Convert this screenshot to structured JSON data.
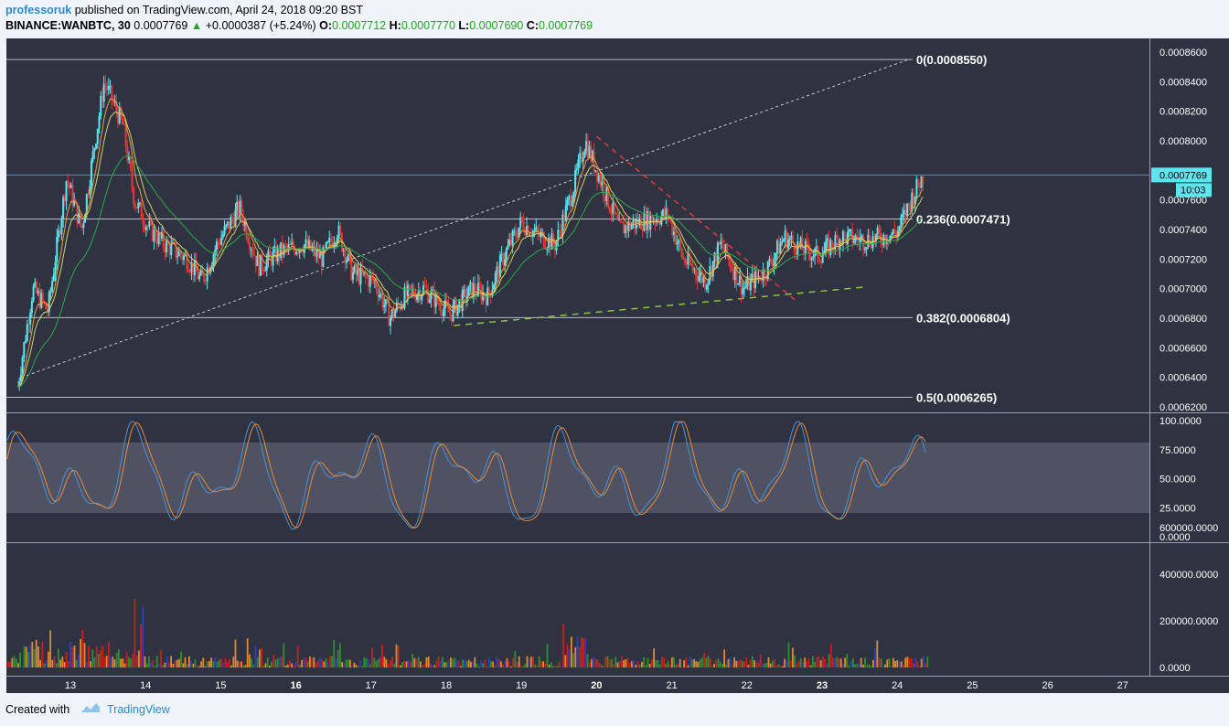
{
  "header": {
    "author": "professoruk",
    "published_text": "published on TradingView.com, April 24, 2018 09:20 BST",
    "symbol": "BINANCE:WANBTC, 30",
    "last": "0.0007769",
    "change_arrow": "▲",
    "change": "+0.0000387 (+5.24%)",
    "o_label": "O:",
    "o": "0.0007712",
    "h_label": "H:",
    "h": "0.0007770",
    "l_label": "L:",
    "l": "0.0007690",
    "c_label": "C:",
    "c": "0.0007769"
  },
  "price_axis": {
    "ticks": [
      "0.0008600",
      "0.0008400",
      "0.0008200",
      "0.0008000",
      "0.0007600",
      "0.0007400",
      "0.0007200",
      "0.0007000",
      "0.0006800",
      "0.0006600",
      "0.0006400",
      "0.0006200"
    ],
    "tick_values": [
      0.00086,
      0.00084,
      0.00082,
      0.0008,
      0.00076,
      0.00074,
      0.00072,
      0.0007,
      0.00068,
      0.00066,
      0.00064,
      0.00062
    ],
    "current_label": "0.0007769",
    "current_value": 0.0007769,
    "countdown": "10:03"
  },
  "fib_levels": [
    {
      "label": "0(0.0008550)",
      "value": 0.000855
    },
    {
      "label": "0.236(0.0007471)",
      "value": 0.0007471
    },
    {
      "label": "0.382(0.0006804)",
      "value": 0.0006804
    },
    {
      "label": "0.5(0.0006265)",
      "value": 0.0006265
    }
  ],
  "stoch_axis": {
    "ticks": [
      "100.0000",
      "75.0000",
      "50.0000",
      "25.0000",
      "0.0000"
    ],
    "tick_values": [
      100,
      75,
      50,
      25,
      0
    ]
  },
  "volume_axis": {
    "ticks": [
      "600000.0000",
      "400000.0000",
      "200000.0000",
      "0.0000"
    ],
    "tick_values": [
      600000,
      400000,
      200000,
      0
    ]
  },
  "time_axis": {
    "labels": [
      "13",
      "14",
      "15",
      "16",
      "17",
      "18",
      "19",
      "20",
      "21",
      "22",
      "23",
      "24",
      "25",
      "26",
      "27"
    ],
    "bold": [
      "16",
      "20",
      "23"
    ]
  },
  "colors": {
    "panel_bg": "#2f3241",
    "candle_up": "#5ee6f0",
    "candle_down": "#e03a3a",
    "ema_fast": "#e8a33a",
    "ema_mid": "#d4d06a",
    "ema_slow": "#2fa84a",
    "stoch_k": "#4a8fd8",
    "stoch_d": "#e88a3a",
    "vol_colors": [
      "#c82020",
      "#2f8f2f",
      "#e08a30",
      "#2a40c8"
    ]
  },
  "chart_data": {
    "type": "candlestick",
    "series": [
      {
        "name": "WANBTC",
        "x_range": [
          12.3,
          24.35
        ],
        "anchors": [
          [
            12.3,
            0.000634
          ],
          [
            12.5,
            0.0007
          ],
          [
            12.7,
            0.000685
          ],
          [
            12.95,
            0.000775
          ],
          [
            13.15,
            0.00074
          ],
          [
            13.45,
            0.00084
          ],
          [
            13.7,
            0.00081
          ],
          [
            13.85,
            0.00076
          ],
          [
            14.05,
            0.00074
          ],
          [
            14.25,
            0.00073
          ],
          [
            14.55,
            0.00072
          ],
          [
            14.75,
            0.000705
          ],
          [
            14.95,
            0.00073
          ],
          [
            15.25,
            0.000755
          ],
          [
            15.5,
            0.000715
          ],
          [
            15.8,
            0.000725
          ],
          [
            16.1,
            0.00073
          ],
          [
            16.35,
            0.00072
          ],
          [
            16.55,
            0.00074
          ],
          [
            16.75,
            0.00071
          ],
          [
            17.05,
            0.000705
          ],
          [
            17.25,
            0.00068
          ],
          [
            17.45,
            0.000695
          ],
          [
            17.7,
            0.0007
          ],
          [
            18.05,
            0.000683
          ],
          [
            18.35,
            0.0007
          ],
          [
            18.55,
            0.000695
          ],
          [
            18.75,
            0.00072
          ],
          [
            19.0,
            0.000745
          ],
          [
            19.25,
            0.000735
          ],
          [
            19.45,
            0.00073
          ],
          [
            19.7,
            0.00077
          ],
          [
            19.85,
            0.0008
          ],
          [
            20.0,
            0.00078
          ],
          [
            20.3,
            0.00074
          ],
          [
            20.55,
            0.000745
          ],
          [
            20.95,
            0.00075
          ],
          [
            21.15,
            0.00072
          ],
          [
            21.45,
            0.000705
          ],
          [
            21.65,
            0.00073
          ],
          [
            21.95,
            0.0007
          ],
          [
            22.25,
            0.000712
          ],
          [
            22.5,
            0.000735
          ],
          [
            22.7,
            0.000728
          ],
          [
            22.95,
            0.000722
          ],
          [
            23.25,
            0.000735
          ],
          [
            23.55,
            0.000733
          ],
          [
            23.8,
            0.000735
          ],
          [
            24.0,
            0.000738
          ],
          [
            24.2,
            0.000762
          ],
          [
            24.35,
            0.000777
          ]
        ]
      }
    ],
    "x_labels": [
      "13",
      "14",
      "15",
      "16",
      "17",
      "18",
      "19",
      "20",
      "21",
      "22",
      "23",
      "24",
      "25",
      "26",
      "27"
    ],
    "y_range": [
      0.000618,
      0.000862
    ]
  }
}
